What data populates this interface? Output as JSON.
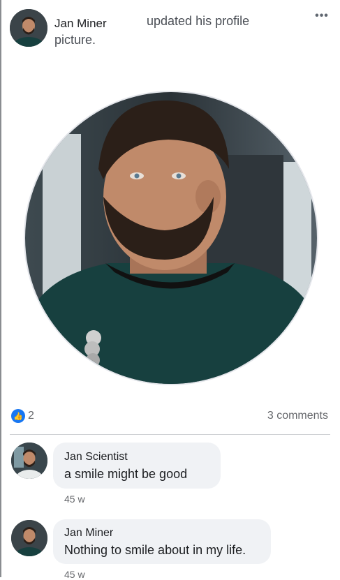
{
  "post": {
    "author": "Jan Miner",
    "action_line1": "updated his profile",
    "action_line2": "picture.",
    "more_label": "•••"
  },
  "reactions": {
    "like_icon": "thumbs-up-icon",
    "like_count": "2",
    "comments_label": "3 comments"
  },
  "comments": [
    {
      "author": "Jan Scientist",
      "text": "a smile might be good",
      "time": "45 w"
    },
    {
      "author": "Jan Miner",
      "text": "Nothing to smile about in my life.",
      "time": "45 w"
    }
  ],
  "colors": {
    "accent": "#1877f2",
    "bubble": "#f0f2f5",
    "shirt": "#17403f"
  }
}
